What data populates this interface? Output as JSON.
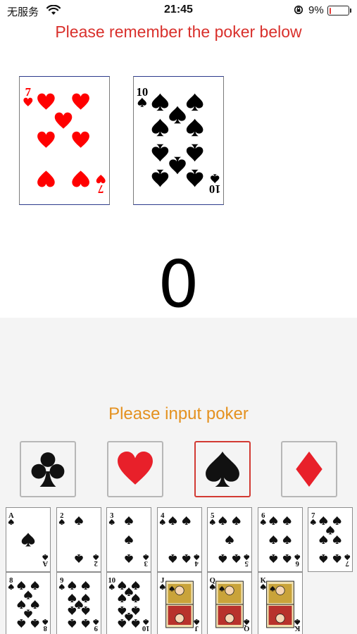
{
  "status_bar": {
    "carrier": "无服务",
    "time": "21:45",
    "battery": "9%",
    "battery_level": 0.09
  },
  "instruction": "Please remember the poker below",
  "memory_cards": [
    {
      "rank": "7",
      "suit": "hearts",
      "color": "#ff0000"
    },
    {
      "rank": "10",
      "suit": "spades",
      "color": "#000000"
    }
  ],
  "score": "0",
  "input_label": "Please input poker",
  "suit_buttons": [
    {
      "suit": "clubs",
      "glyph": "♣",
      "color": "#111111",
      "selected": false
    },
    {
      "suit": "hearts",
      "glyph": "♥",
      "color": "#e8202a",
      "selected": false
    },
    {
      "suit": "spades",
      "glyph": "♠",
      "color": "#111111",
      "selected": true
    },
    {
      "suit": "diamonds",
      "glyph": "♦",
      "color": "#e8202a",
      "selected": false
    }
  ],
  "rank_cards": [
    {
      "rank": "A"
    },
    {
      "rank": "2"
    },
    {
      "rank": "3"
    },
    {
      "rank": "4"
    },
    {
      "rank": "5"
    },
    {
      "rank": "6"
    },
    {
      "rank": "7"
    },
    {
      "rank": "8"
    },
    {
      "rank": "9"
    },
    {
      "rank": "10"
    },
    {
      "rank": "J"
    },
    {
      "rank": "Q"
    },
    {
      "rank": "K"
    }
  ],
  "rank_card_suit": "spades",
  "colors": {
    "instruction": "#d9302c",
    "input_label": "#e4911f",
    "selected_border": "#d23a33",
    "panel_background": "#f4f4f4"
  }
}
